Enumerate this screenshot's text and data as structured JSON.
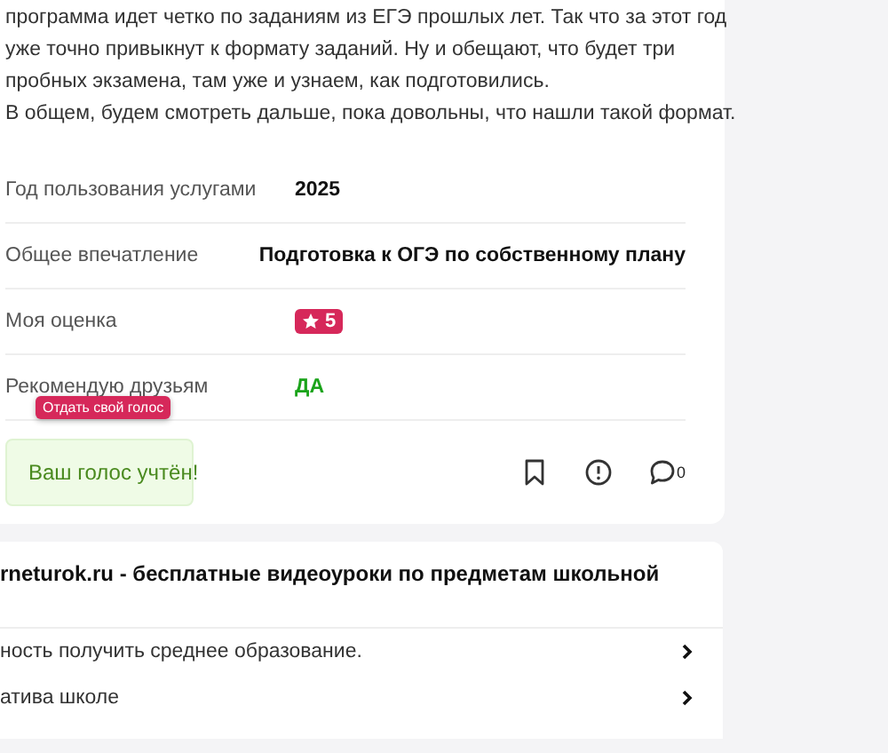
{
  "review": {
    "paragraph_lines": [
      "программа идет четко по заданиям из ЕГЭ прошлых лет. Так что за этот год",
      "уже точно привыкнут к формату заданий. Ну и обещают, что будет три",
      "пробных экзамена, там уже и узнаем, как подготовились.",
      "В общем, будем смотреть дальше, пока довольны, что нашли такой формат."
    ],
    "details": [
      {
        "label": "Год пользования услугами",
        "value": "2025",
        "kind": "text"
      },
      {
        "label": "Общее впечатление",
        "value": "Подготовка к ОГЭ по собственному плану",
        "kind": "text"
      },
      {
        "label": "Моя оценка",
        "value": "5",
        "kind": "rating"
      },
      {
        "label": "Рекомендую друзьям",
        "value": "ДА",
        "kind": "yes"
      }
    ],
    "tooltip": "Отдать свой голос",
    "vote_status": "Ваш голос учтён!",
    "comment_count": "0"
  },
  "related": {
    "title": "rneturok.ru - бесплатные видеоуроки по предметам школьной",
    "items": [
      "ность получить среднее образование.",
      "атива школе"
    ]
  }
}
